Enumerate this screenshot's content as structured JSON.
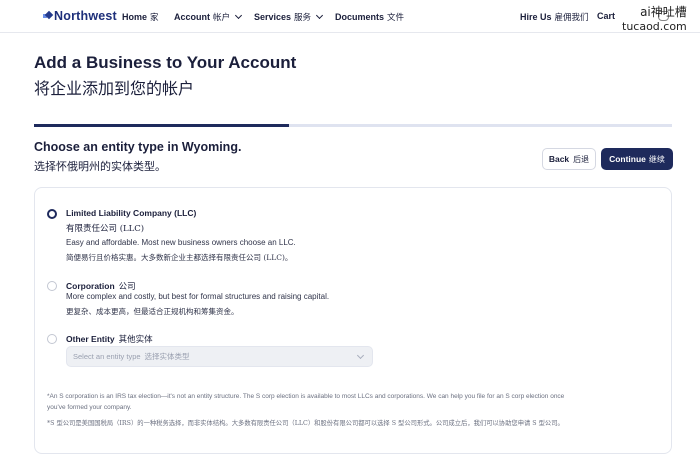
{
  "nav": {
    "logo": "Northwest",
    "home": "Home",
    "home_cn": "家",
    "account": "Account",
    "account_cn": "帐户",
    "services": "Services",
    "services_cn": "服务",
    "documents": "Documents",
    "documents_cn": "文件",
    "hire_us": "Hire Us",
    "hire_us_cn": "雇佣我们",
    "cart": "Cart"
  },
  "watermark": {
    "line1": "ai神吐槽",
    "line2": "tucaod.com"
  },
  "header": {
    "title": "Add a Business to Your Account",
    "title_cn": "将企业添加到您的帐户"
  },
  "progress": {
    "fraction": 0.4
  },
  "step": {
    "title": "Choose an entity type in Wyoming.",
    "title_cn": "选择怀俄明州的实体类型。",
    "back_label": "Back",
    "back_cn": "后退",
    "continue_label": "Continue",
    "continue_cn": "继续"
  },
  "options": [
    {
      "label": "Limited Liability Company (LLC)",
      "label_cn": "有限责任公司 (LLC)",
      "desc": "Easy and affordable. Most new business owners choose an LLC.",
      "desc_cn": "简便易行且价格实惠。大多数新企业主都选择有限责任公司 (LLC)。",
      "selected": true
    },
    {
      "label": "Corporation",
      "label_cn": "公司",
      "desc": "More complex and costly, but best for formal structures and raising capital.",
      "desc_cn": "更复杂、成本更高，但最适合正规机构和筹集资金。",
      "selected": false
    },
    {
      "label": "Other Entity",
      "label_cn": "其他实体",
      "selected": false
    }
  ],
  "select": {
    "placeholder": "Select an entity type",
    "placeholder_cn": "选择实体类型"
  },
  "footnote": {
    "line1": "*An S corporation is an IRS tax election—it's not an entity structure. The S corp election is available to most LLCs and corporations. We can help you file for an S corp election once",
    "line2": "you've formed your company.",
    "line3_cn": "*S 型公司是美国国税局（IRS）的一种税务选择，而非实体结构。大多数有限责任公司（LLC）和股份有限公司都可以选择 S 型公司形式。公司成立后，我们可以协助您申请 S 型公司。"
  },
  "colors": {
    "primary": "#1e2a5c",
    "logo": "#1e2f7a",
    "progress_track": "#dfe3f0"
  }
}
